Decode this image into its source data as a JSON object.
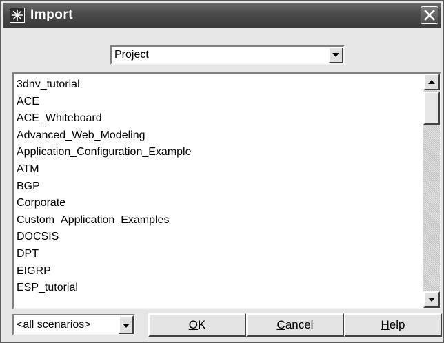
{
  "window": {
    "title": "Import"
  },
  "source_select": {
    "value": "Project"
  },
  "projects": {
    "items": [
      "3dnv_tutorial",
      "ACE",
      "ACE_Whiteboard",
      "Advanced_Web_Modeling",
      "Application_Configuration_Example",
      "ATM",
      "BGP",
      "Corporate",
      "Custom_Application_Examples",
      "DOCSIS",
      "DPT",
      "EIGRP",
      "ESP_tutorial"
    ]
  },
  "scenario_select": {
    "value": "<all scenarios>"
  },
  "buttons": {
    "ok": {
      "mnemonic": "O",
      "rest": "K"
    },
    "cancel": {
      "mnemonic": "C",
      "rest": "ancel"
    },
    "help": {
      "mnemonic": "H",
      "rest": "elp"
    }
  },
  "icons": {
    "window_icon": "star-burst-icon",
    "close": "close-x-icon",
    "dropdown": "triangle-down-icon",
    "scroll_up": "triangle-up-icon",
    "scroll_down": "triangle-down-icon"
  }
}
